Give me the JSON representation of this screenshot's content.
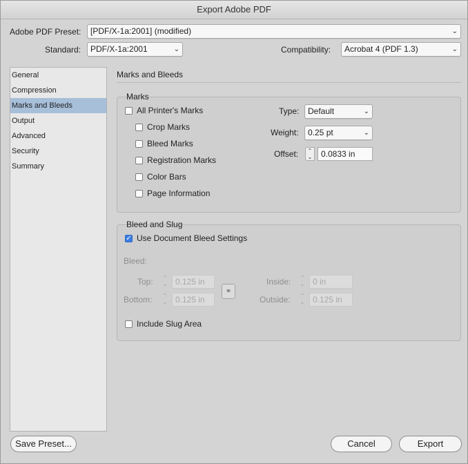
{
  "window": {
    "title": "Export Adobe PDF"
  },
  "top": {
    "preset_label": "Adobe PDF Preset:",
    "preset_value": "[PDF/X-1a:2001] (modified)",
    "standard_label": "Standard:",
    "standard_value": "PDF/X-1a:2001",
    "compatibility_label": "Compatibility:",
    "compatibility_value": "Acrobat 4 (PDF 1.3)"
  },
  "sidebar": {
    "items": [
      {
        "label": "General"
      },
      {
        "label": "Compression"
      },
      {
        "label": "Marks and Bleeds"
      },
      {
        "label": "Output"
      },
      {
        "label": "Advanced"
      },
      {
        "label": "Security"
      },
      {
        "label": "Summary"
      }
    ],
    "selected": "Marks and Bleeds"
  },
  "panel": {
    "title": "Marks and Bleeds",
    "marks": {
      "group_label": "Marks",
      "all_printers_marks": "All Printer's Marks",
      "crop_marks": "Crop Marks",
      "bleed_marks": "Bleed Marks",
      "registration_marks": "Registration Marks",
      "color_bars": "Color Bars",
      "page_information": "Page Information",
      "type_label": "Type:",
      "type_value": "Default",
      "weight_label": "Weight:",
      "weight_value": "0.25 pt",
      "offset_label": "Offset:",
      "offset_value": "0.0833 in"
    },
    "bleed": {
      "group_label": "Bleed and Slug",
      "use_document_bleed": "Use Document Bleed Settings",
      "bleed_label": "Bleed:",
      "top_label": "Top:",
      "top_value": "0.125 in",
      "bottom_label": "Bottom:",
      "bottom_value": "0.125 in",
      "inside_label": "Inside:",
      "inside_value": "0 in",
      "outside_label": "Outside:",
      "outside_value": "0.125 in",
      "include_slug": "Include Slug Area"
    }
  },
  "footer": {
    "save_preset": "Save Preset...",
    "cancel": "Cancel",
    "export": "Export"
  },
  "colors": {
    "selection": "#a7bfd9",
    "checkbox_checked": "#3b7de1"
  }
}
